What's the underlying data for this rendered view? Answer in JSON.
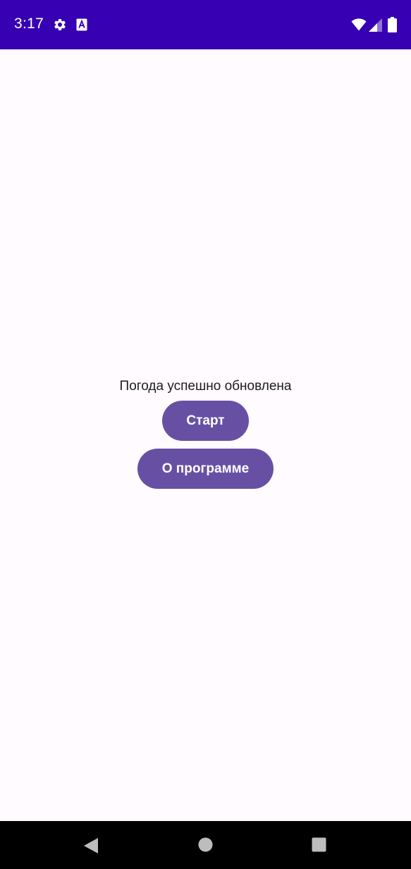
{
  "status_bar": {
    "time": "3:17",
    "background_color": "#3700b3",
    "icons": [
      "gear-icon",
      "a-box-icon",
      "wifi-icon",
      "signal-icon",
      "battery-icon"
    ]
  },
  "main": {
    "message": "Погода успешно обновлена",
    "start_button_label": "Старт",
    "about_button_label": "О программе",
    "button_color": "#6750a4",
    "background_color": "#fffbfe"
  },
  "nav_bar": {
    "icons": [
      "back-icon",
      "home-icon",
      "recents-icon"
    ],
    "background_color": "#000000"
  }
}
